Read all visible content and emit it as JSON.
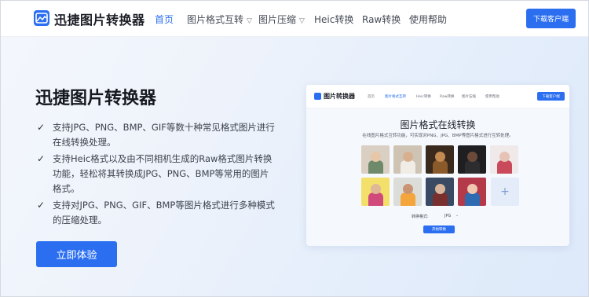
{
  "header": {
    "logo_text": "迅捷图片转换器",
    "nav": [
      {
        "label": "首页",
        "active": true
      },
      {
        "label": "图片格式互转",
        "dropdown": true
      },
      {
        "label": "图片压缩",
        "dropdown": true
      },
      {
        "label": "Heic转换"
      },
      {
        "label": "Raw转换"
      },
      {
        "label": "使用帮助"
      }
    ],
    "download_label": "下载客户端"
  },
  "hero": {
    "title": "迅捷图片转换器",
    "features": [
      "支持JPG、PNG、BMP、GIF等数十种常见格式图片进行在线转换处理。",
      "支持Heic格式以及由不同相机生成的Raw格式图片转换功能，轻松将其转换成JPG、PNG、BMP等常用的图片格式。",
      "支持对JPG、PNG、GIF、BMP等图片格式进行多种模式的压缩处理。"
    ],
    "cta_label": "立即体验"
  },
  "preview": {
    "logo_text": "图片转换器",
    "nav": [
      "首页",
      "图片格式互转",
      "Heic转换",
      "Raw转换",
      "图片压缩",
      "使用帮助"
    ],
    "download_label": "下载客户端",
    "title": "图片格式在线转换",
    "subtitle": "在线图片格式互转功能，可实现对PNG、JPG、BMP等图片格式进行互转处理。",
    "format_label": "转换格式:",
    "format_value": "JPG",
    "start_label": "开始转换",
    "add_icon": "+",
    "thumbnails": [
      {
        "bg": "#d9cfc3",
        "skin": "#e8c7a8",
        "cloth": "#6f8a6a"
      },
      {
        "bg": "#cfc4b4",
        "skin": "#d9b08f",
        "cloth": "#f1ede6"
      },
      {
        "bg": "#3a2a1d",
        "skin": "#c48a52",
        "cloth": "#8a5a2b"
      },
      {
        "bg": "#1f1f22",
        "skin": "#6b4a3a",
        "cloth": "#2d2d30"
      },
      {
        "bg": "#efe9ea",
        "skin": "#e6c3b5",
        "cloth": "#c94a5a"
      },
      {
        "bg": "#f2e06b",
        "skin": "#e0b898",
        "cloth": "#d04b7b"
      },
      {
        "bg": "#dcdcd8",
        "skin": "#c99474",
        "cloth": "#f4a53b"
      },
      {
        "bg": "#3a4a63",
        "skin": "#d8b59a",
        "cloth": "#7a2f2f"
      },
      {
        "bg": "#b43a4a",
        "skin": "#f0c7b0",
        "cloth": "#2e6bb0"
      }
    ]
  }
}
